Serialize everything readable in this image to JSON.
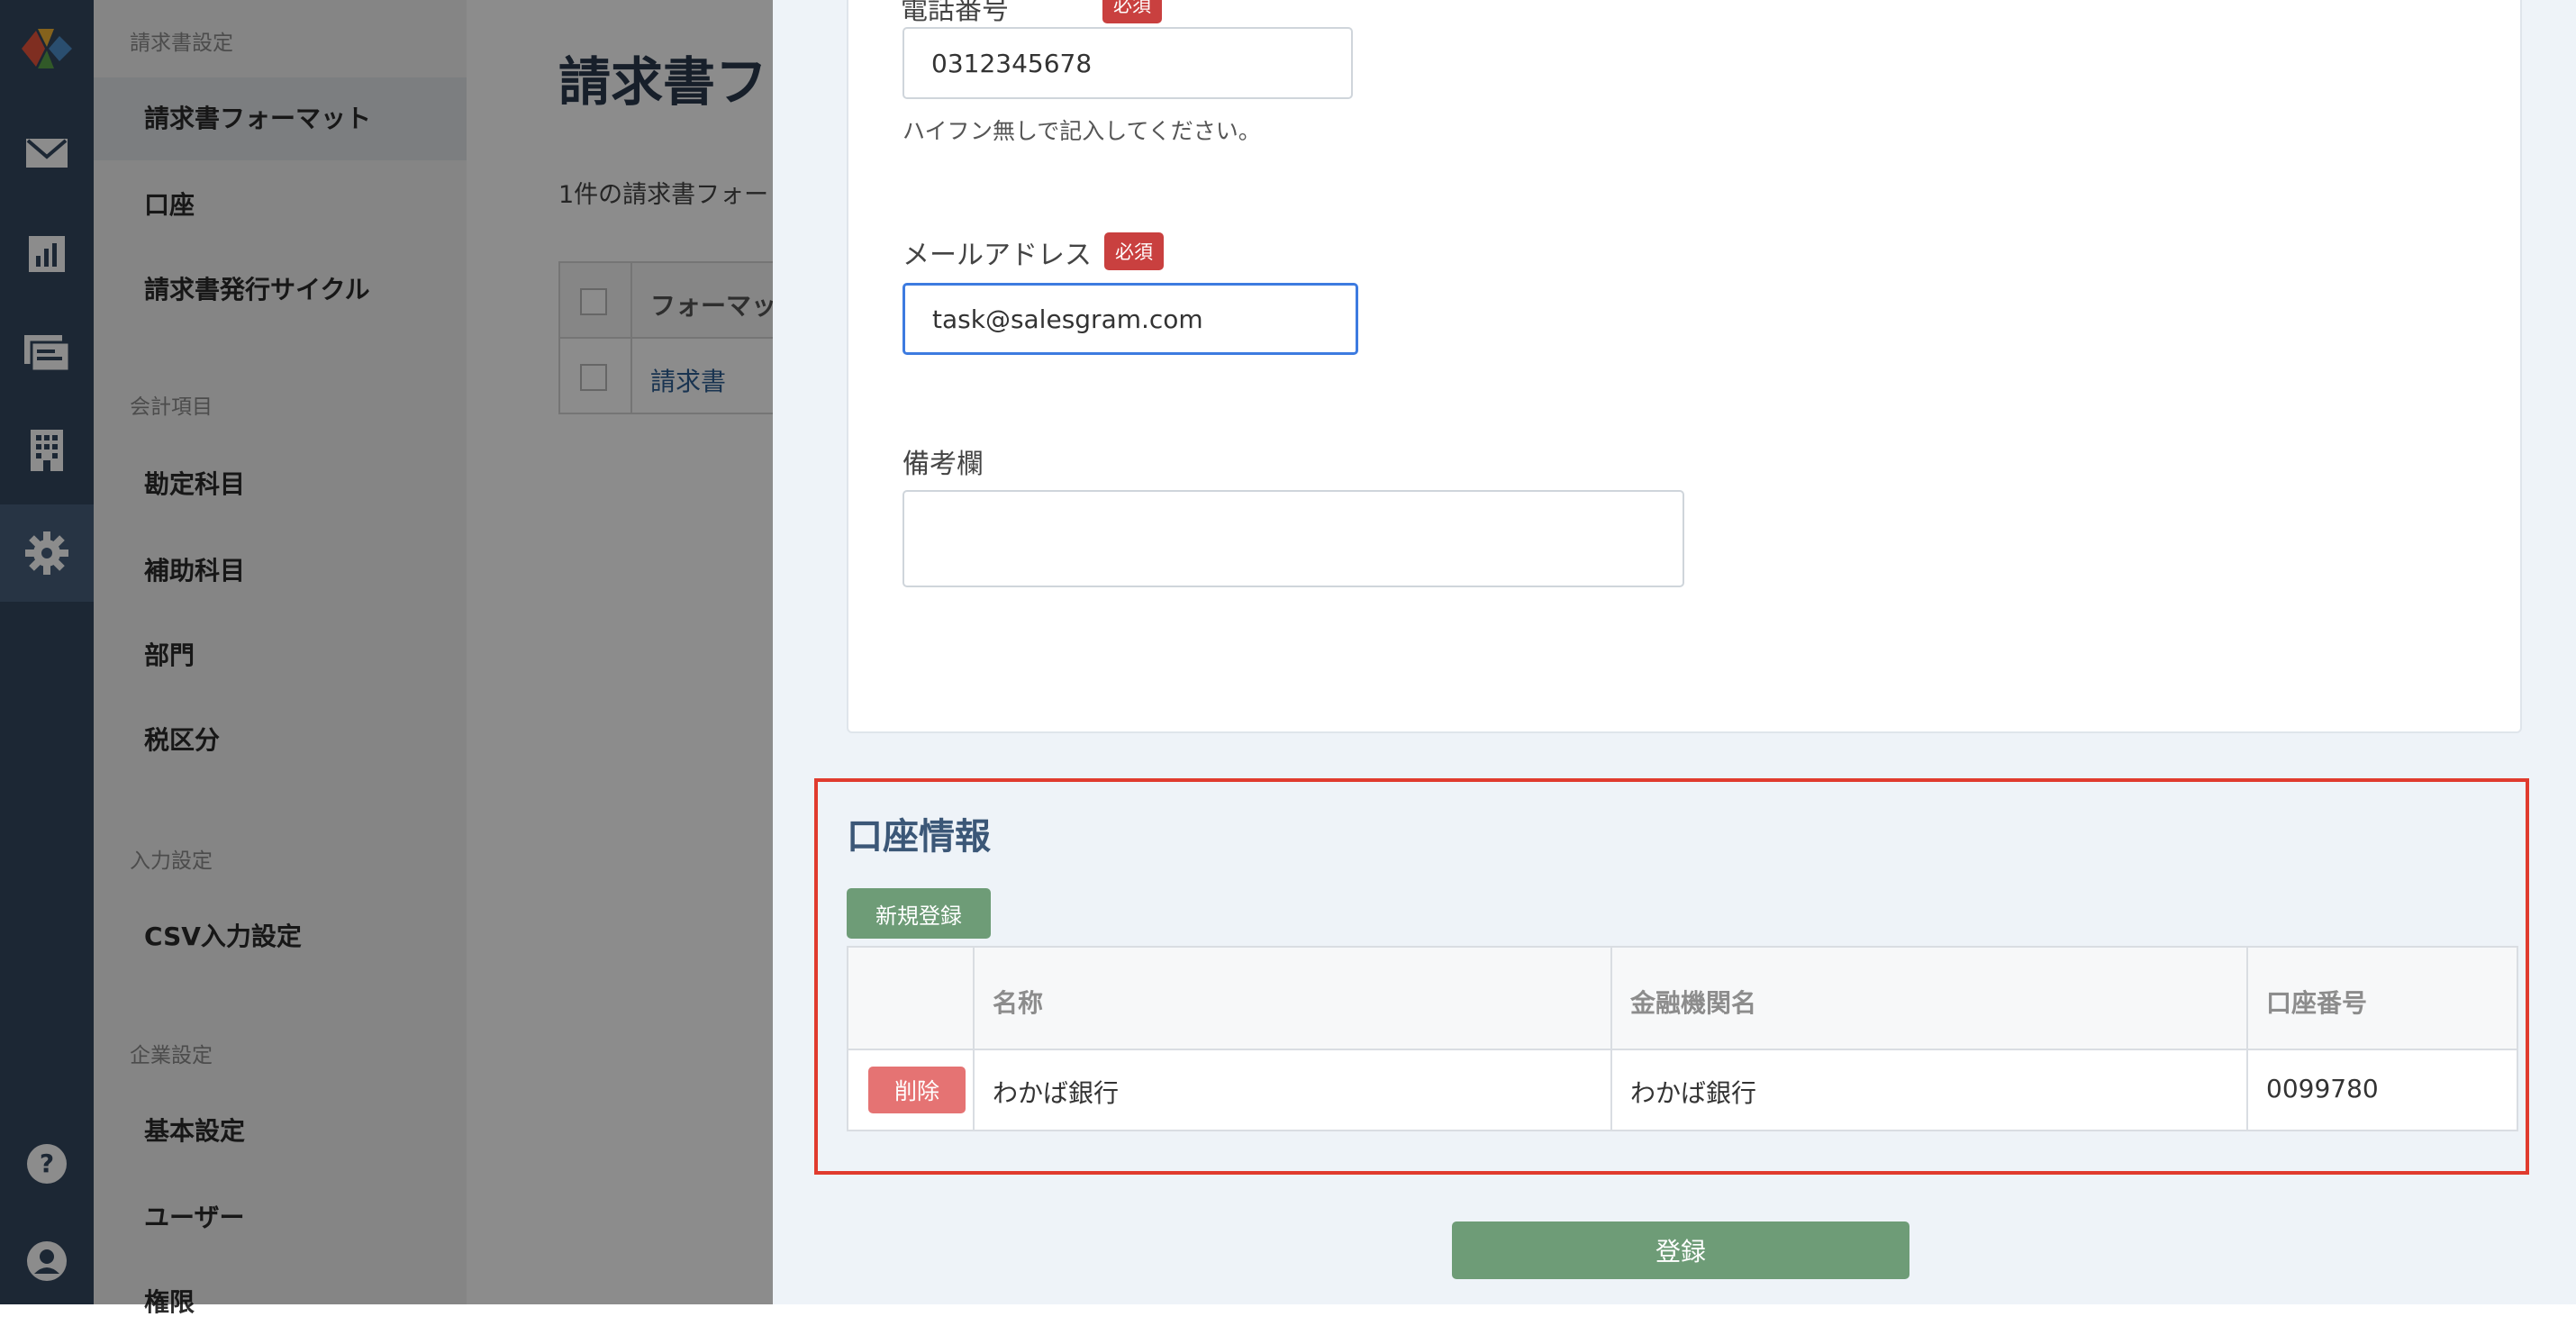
{
  "rail": {
    "icons": [
      "logo-icon",
      "mail-icon",
      "chart-icon",
      "invoice-icon",
      "building-icon",
      "gear-icon",
      "help-icon",
      "user-icon"
    ]
  },
  "nav": {
    "sections": {
      "invoice": "請求書設定",
      "accounting": "会計項目",
      "input": "入力設定",
      "company": "企業設定"
    },
    "items": {
      "format": "請求書フォーマット",
      "account": "口座",
      "cycle": "請求書発行サイクル",
      "subject": "勘定科目",
      "subsubject": "補助科目",
      "dept": "部門",
      "tax": "税区分",
      "csv": "CSV入力設定",
      "basic": "基本設定",
      "user": "ユーザー",
      "perm": "権限"
    }
  },
  "background": {
    "title": "請求書フ",
    "count_text": "1件の請求書フォー",
    "table_header": "フォーマッ",
    "row_link": "請求書"
  },
  "form": {
    "phone": {
      "label": "電話番号",
      "required": "必須",
      "value": "0312345678",
      "hint": "ハイフン無しで記入してください。"
    },
    "email": {
      "label": "メールアドレス",
      "required": "必須",
      "value": "task@salesgram.com"
    },
    "memo": {
      "label": "備考欄",
      "value": ""
    }
  },
  "accounts": {
    "title": "口座情報",
    "new_button": "新規登録",
    "columns": [
      "名称",
      "金融機関名",
      "口座番号"
    ],
    "rows": [
      {
        "delete": "削除",
        "name": "わかば銀行",
        "bank": "わかば銀行",
        "number": "0099780"
      }
    ]
  },
  "submit_label": "登録",
  "colors": {
    "rail": "#34475f",
    "accent_green": "#6e9c77",
    "required_red": "#c9403f",
    "highlight": "#e03b2e",
    "delete": "#e57373"
  }
}
